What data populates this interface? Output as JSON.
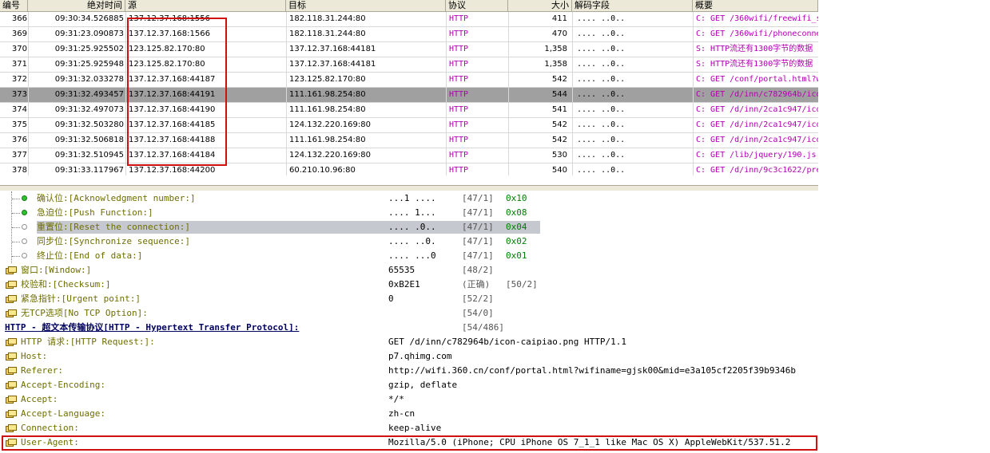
{
  "columns": {
    "no": "编号",
    "time": "绝对时间",
    "src": "源",
    "dst": "目标",
    "proto": "协议",
    "size": "大小",
    "decode": "解码字段",
    "summary": "概要"
  },
  "packets": [
    {
      "no": "366",
      "time": "09:30:34.526885",
      "src": "137.12.37.168:1556",
      "dst": "182.118.31.244:80",
      "proto": "HTTP",
      "size": "411",
      "decode": ".... ..0..",
      "summary": "C: GET /360wifi/freewifi_s"
    },
    {
      "no": "369",
      "time": "09:31:23.090873",
      "src": "137.12.37.168:1566",
      "dst": "182.118.31.244:80",
      "proto": "HTTP",
      "size": "470",
      "decode": ".... ..0..",
      "summary": "C: GET /360wifi/phoneconne"
    },
    {
      "no": "370",
      "time": "09:31:25.925502",
      "src": "123.125.82.170:80",
      "dst": "137.12.37.168:44181",
      "proto": "HTTP",
      "size": "1,358",
      "decode": ".... ..0..",
      "summary": "S: HTTP流还有1300字节的数据"
    },
    {
      "no": "371",
      "time": "09:31:25.925948",
      "src": "123.125.82.170:80",
      "dst": "137.12.37.168:44181",
      "proto": "HTTP",
      "size": "1,358",
      "decode": ".... ..0..",
      "summary": "S: HTTP流还有1300字节的数据"
    },
    {
      "no": "372",
      "time": "09:31:32.033278",
      "src": "137.12.37.168:44187",
      "dst": "123.125.82.170:80",
      "proto": "HTTP",
      "size": "542",
      "decode": ".... ..0..",
      "summary": "C: GET /conf/portal.html?w"
    },
    {
      "no": "373",
      "time": "09:31:32.493457",
      "src": "137.12.37.168:44191",
      "dst": "111.161.98.254:80",
      "proto": "HTTP",
      "size": "544",
      "decode": ".... ..0..",
      "summary": "C: GET /d/inn/c782964b/ico"
    },
    {
      "no": "374",
      "time": "09:31:32.497073",
      "src": "137.12.37.168:44190",
      "dst": "111.161.98.254:80",
      "proto": "HTTP",
      "size": "541",
      "decode": ".... ..0..",
      "summary": "C: GET /d/inn/2ca1c947/ico"
    },
    {
      "no": "375",
      "time": "09:31:32.503280",
      "src": "137.12.37.168:44185",
      "dst": "124.132.220.169:80",
      "proto": "HTTP",
      "size": "542",
      "decode": ".... ..0..",
      "summary": "C: GET /d/inn/2ca1c947/ico"
    },
    {
      "no": "376",
      "time": "09:31:32.506818",
      "src": "137.12.37.168:44188",
      "dst": "111.161.98.254:80",
      "proto": "HTTP",
      "size": "542",
      "decode": ".... ..0..",
      "summary": "C: GET /d/inn/2ca1c947/ico"
    },
    {
      "no": "377",
      "time": "09:31:32.510945",
      "src": "137.12.37.168:44184",
      "dst": "124.132.220.169:80",
      "proto": "HTTP",
      "size": "530",
      "decode": ".... ..0..",
      "summary": "C: GET /lib/jquery/190.js"
    },
    {
      "no": "378",
      "time": "09:31:33.117967",
      "src": "137.12.37.168:44200",
      "dst": "60.210.10.96:80",
      "proto": "HTTP",
      "size": "540",
      "decode": ".... ..0..",
      "summary": "C: GET /d/inn/9c3c1622/pre"
    }
  ],
  "details": [
    {
      "label": "确认位:[Acknowledgment number:]",
      "value": "...1 ....",
      "pos": "[47/1]",
      "hex": "0x10",
      "icon": "dot-on"
    },
    {
      "label": "急迫位:[Push Function:]",
      "value": ".... 1...",
      "pos": "[47/1]",
      "hex": "0x08",
      "icon": "dot-on"
    },
    {
      "label": "重置位:[Reset the connection:]",
      "value": ".... .0..",
      "pos": "[47/1]",
      "hex": "0x04",
      "icon": "dot-off"
    },
    {
      "label": "同步位:[Synchronize sequence:]",
      "value": ".... ..0.",
      "pos": "[47/1]",
      "hex": "0x02",
      "icon": "dot-off"
    },
    {
      "label": "终止位:[End of data:]",
      "value": ".... ...0",
      "pos": "[47/1]",
      "hex": "0x01",
      "icon": "dot-off"
    },
    {
      "label": "窗口:[Window:]",
      "value": "65535",
      "pos": "[48/2]",
      "hex": "",
      "icon": "folder"
    },
    {
      "label": "校验和:[Checksum:]",
      "value": "0xB2E1",
      "pos": "(正确)",
      "hex": "[50/2]",
      "icon": "folder"
    },
    {
      "label": "紧急指针:[Urgent point:]",
      "value": "0",
      "pos": "[52/2]",
      "hex": "",
      "icon": "folder"
    },
    {
      "label": "无TCP选项[No TCP Option]:",
      "value": "",
      "pos": "[54/0]",
      "hex": "",
      "icon": "folder"
    },
    {
      "label": "HTTP - 超文本传输协议[HTTP - Hypertext Transfer Protocol]:",
      "value": "",
      "pos": "[54/486]",
      "hex": "",
      "icon": "none"
    },
    {
      "label": "HTTP 请求:[HTTP Request:]:",
      "value": "GET /d/inn/c782964b/icon-caipiao.png HTTP/1.1",
      "pos": "",
      "hex": "",
      "icon": "folder"
    },
    {
      "label": "Host:",
      "value": "p7.qhimg.com",
      "pos": "",
      "hex": "",
      "icon": "folder"
    },
    {
      "label": "Referer:",
      "value": "http://wifi.360.cn/conf/portal.html?wifiname=gjsk00&mid=e3a105cf2205f39b9346b",
      "pos": "",
      "hex": "",
      "icon": "folder"
    },
    {
      "label": "Accept-Encoding:",
      "value": "gzip, deflate",
      "pos": "",
      "hex": "",
      "icon": "folder"
    },
    {
      "label": "Accept:",
      "value": "*/*",
      "pos": "",
      "hex": "",
      "icon": "folder"
    },
    {
      "label": "Accept-Language:",
      "value": "zh-cn",
      "pos": "",
      "hex": "",
      "icon": "folder"
    },
    {
      "label": "Connection:",
      "value": "keep-alive",
      "pos": "",
      "hex": "",
      "icon": "folder"
    },
    {
      "label": "User-Agent:",
      "value": "Mozilla/5.0 (iPhone; CPU iPhone OS 7_1_1 like Mac OS X) AppleWebKit/537.51.2",
      "pos": "",
      "hex": "",
      "icon": "folder"
    }
  ],
  "colors": {
    "highlight_box": "#d01010",
    "selected_row": "#a0a0a0",
    "protocol_text": "#b000b0",
    "label_text": "#6e6e00"
  }
}
